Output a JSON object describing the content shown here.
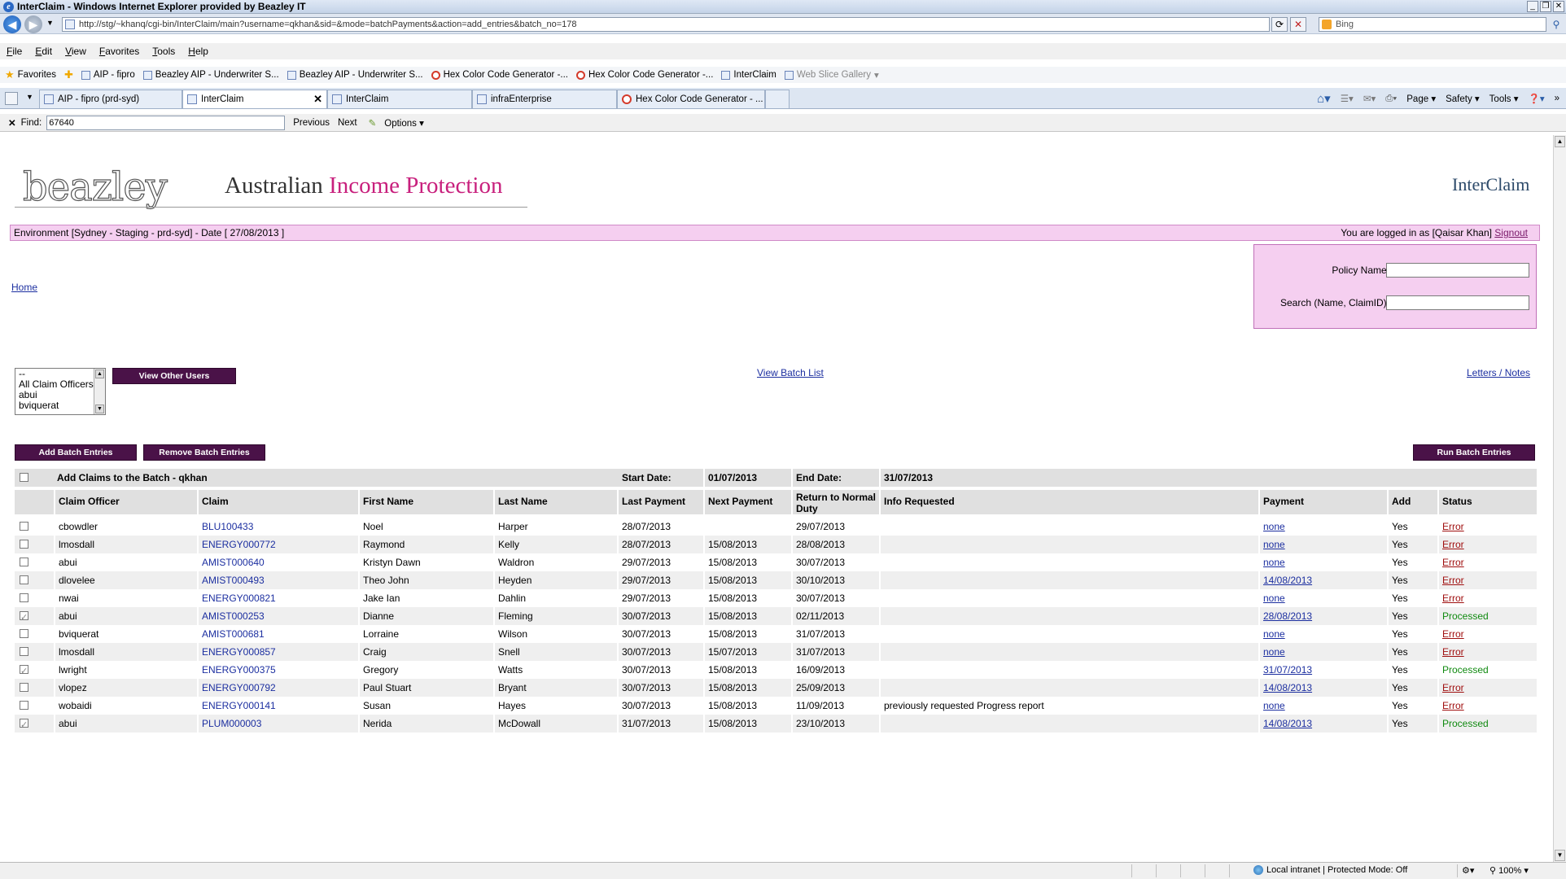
{
  "window": {
    "title": "InterClaim - Windows Internet Explorer provided by Beazley IT",
    "controls": [
      "_",
      "❐",
      "✕"
    ]
  },
  "address": {
    "url": "http://stg/~khanq/cgi-bin/InterClaim/main?username=qkhan&sid=&mode=batchPayments&action=add_entries&batch_no=178",
    "search_placeholder": "Bing"
  },
  "menu": [
    "File",
    "Edit",
    "View",
    "Favorites",
    "Tools",
    "Help"
  ],
  "favorites": {
    "label": "Favorites",
    "items": [
      {
        "label": "AIP - fipro",
        "icon": "page-icon"
      },
      {
        "label": "Beazley AIP - Underwriter S...",
        "icon": "page-icon"
      },
      {
        "label": "Beazley AIP - Underwriter S...",
        "icon": "page-icon"
      },
      {
        "label": "Hex Color Code Generator -...",
        "icon": "hex-icon"
      },
      {
        "label": "Hex Color Code Generator -...",
        "icon": "hex-icon"
      },
      {
        "label": "InterClaim",
        "icon": "page-icon"
      },
      {
        "label": "Web Slice Gallery",
        "icon": "web-slice-icon"
      }
    ]
  },
  "tabs": [
    {
      "label": "AIP - fipro (prd-syd)",
      "icon": "page-icon"
    },
    {
      "label": "InterClaim",
      "icon": "page-icon",
      "active": true,
      "close": "✕"
    },
    {
      "label": "InterClaim",
      "icon": "page-icon"
    },
    {
      "label": "infraEnterprise",
      "icon": "page-icon"
    },
    {
      "label": "Hex Color Code Generator - ...",
      "icon": "hex-icon"
    }
  ],
  "command_bar": {
    "page": "Page",
    "safety": "Safety",
    "tools": "Tools"
  },
  "find": {
    "label": "Find:",
    "value": "67640",
    "previous": "Previous",
    "next": "Next",
    "options": "Options"
  },
  "header": {
    "logo": "beazley",
    "product_prefix": "Australian",
    "product_highlight": "Income Protection",
    "app_name": "InterClaim"
  },
  "env": {
    "text": "Environment [Sydney - Staging - prd-syd] - Date [ 27/08/2013 ]",
    "logged_in": "You are logged in as [Qaisar Khan]",
    "signout": "Signout"
  },
  "nav": {
    "home": "Home"
  },
  "search_panel": {
    "policy_label": "Policy Name:",
    "search_label": "Search (Name, ClaimID):"
  },
  "officers": {
    "options": [
      "--",
      "All Claim Officers",
      "abui",
      "bviquerat"
    ],
    "view_button": "View Other Users"
  },
  "links": {
    "view_batch_list": "View Batch List",
    "letters_notes": "Letters / Notes"
  },
  "actions": {
    "add": "Add Batch Entries",
    "remove": "Remove Batch Entries",
    "run": "Run Batch Entries"
  },
  "batch": {
    "title": "Add Claims to the Batch - qkhan",
    "start_label": "Start Date:",
    "start_value": "01/07/2013",
    "end_label": "End Date:",
    "end_value": "31/07/2013"
  },
  "columns": {
    "officer": "Claim Officer",
    "claim": "Claim",
    "first": "First Name",
    "last": "Last Name",
    "last_payment": "Last Payment",
    "next_payment": "Next Payment",
    "return": "Return to Normal Duty",
    "info": "Info Requested",
    "payment": "Payment",
    "add": "Add",
    "status": "Status"
  },
  "rows": [
    {
      "checked": false,
      "officer": "cbowdler",
      "claim": "BLU100433",
      "first": "Noel",
      "last": "Harper",
      "last_payment": "28/07/2013",
      "next_payment": "",
      "return": "29/07/2013",
      "info": "",
      "payment": "none",
      "add": "Yes",
      "status": "Error"
    },
    {
      "checked": false,
      "officer": "lmosdall",
      "claim": "ENERGY000772",
      "first": "Raymond",
      "last": "Kelly",
      "last_payment": "28/07/2013",
      "next_payment": "15/08/2013",
      "return": "28/08/2013",
      "info": "",
      "payment": "none",
      "add": "Yes",
      "status": "Error"
    },
    {
      "checked": false,
      "officer": "abui",
      "claim": "AMIST000640",
      "first": "Kristyn Dawn",
      "last": "Waldron",
      "last_payment": "29/07/2013",
      "next_payment": "15/08/2013",
      "return": "30/07/2013",
      "info": "",
      "payment": "none",
      "add": "Yes",
      "status": "Error"
    },
    {
      "checked": false,
      "officer": "dlovelee",
      "claim": "AMIST000493",
      "first": "Theo John",
      "last": "Heyden",
      "last_payment": "29/07/2013",
      "next_payment": "15/08/2013",
      "return": "30/10/2013",
      "info": "",
      "payment": "14/08/2013",
      "add": "Yes",
      "status": "Error"
    },
    {
      "checked": false,
      "officer": "nwai",
      "claim": "ENERGY000821",
      "first": "Jake Ian",
      "last": "Dahlin",
      "last_payment": "29/07/2013",
      "next_payment": "15/08/2013",
      "return": "30/07/2013",
      "info": "",
      "payment": "none",
      "add": "Yes",
      "status": "Error"
    },
    {
      "checked": true,
      "officer": "abui",
      "claim": "AMIST000253",
      "first": "Dianne",
      "last": "Fleming",
      "last_payment": "30/07/2013",
      "next_payment": "15/08/2013",
      "return": "02/11/2013",
      "info": "",
      "payment": "28/08/2013",
      "add": "Yes",
      "status": "Processed"
    },
    {
      "checked": false,
      "officer": "bviquerat",
      "claim": "AMIST000681",
      "first": "Lorraine",
      "last": "Wilson",
      "last_payment": "30/07/2013",
      "next_payment": "15/08/2013",
      "return": "31/07/2013",
      "info": "",
      "payment": "none",
      "add": "Yes",
      "status": "Error"
    },
    {
      "checked": false,
      "officer": "lmosdall",
      "claim": "ENERGY000857",
      "first": "Craig",
      "last": "Snell",
      "last_payment": "30/07/2013",
      "next_payment": "15/07/2013",
      "return": "31/07/2013",
      "info": "",
      "payment": "none",
      "add": "Yes",
      "status": "Error"
    },
    {
      "checked": true,
      "officer": "lwright",
      "claim": "ENERGY000375",
      "first": "Gregory",
      "last": "Watts",
      "last_payment": "30/07/2013",
      "next_payment": "15/08/2013",
      "return": "16/09/2013",
      "info": "",
      "payment": "31/07/2013",
      "add": "Yes",
      "status": "Processed"
    },
    {
      "checked": false,
      "officer": "vlopez",
      "claim": "ENERGY000792",
      "first": "Paul Stuart",
      "last": "Bryant",
      "last_payment": "30/07/2013",
      "next_payment": "15/08/2013",
      "return": "25/09/2013",
      "info": "",
      "payment": "14/08/2013",
      "add": "Yes",
      "status": "Error"
    },
    {
      "checked": false,
      "officer": "wobaidi",
      "claim": "ENERGY000141",
      "first": "Susan",
      "last": "Hayes",
      "last_payment": "30/07/2013",
      "next_payment": "15/08/2013",
      "return": "11/09/2013",
      "info": "previously requested Progress report",
      "payment": "none",
      "add": "Yes",
      "status": "Error"
    },
    {
      "checked": true,
      "officer": "abui",
      "claim": "PLUM000003",
      "first": "Nerida",
      "last": "McDowall",
      "last_payment": "31/07/2013",
      "next_payment": "15/08/2013",
      "return": "23/10/2013",
      "info": "",
      "payment": "14/08/2013",
      "add": "Yes",
      "status": "Processed"
    }
  ],
  "status_bar": {
    "zone": "Local intranet | Protected Mode: Off",
    "zoom": "100%"
  },
  "colors": {
    "brand_purple": "#4a1248",
    "highlight_pink": "#c8207d",
    "env_bg": "#f5cff0",
    "error": "#a01010",
    "processed": "#108a10"
  }
}
